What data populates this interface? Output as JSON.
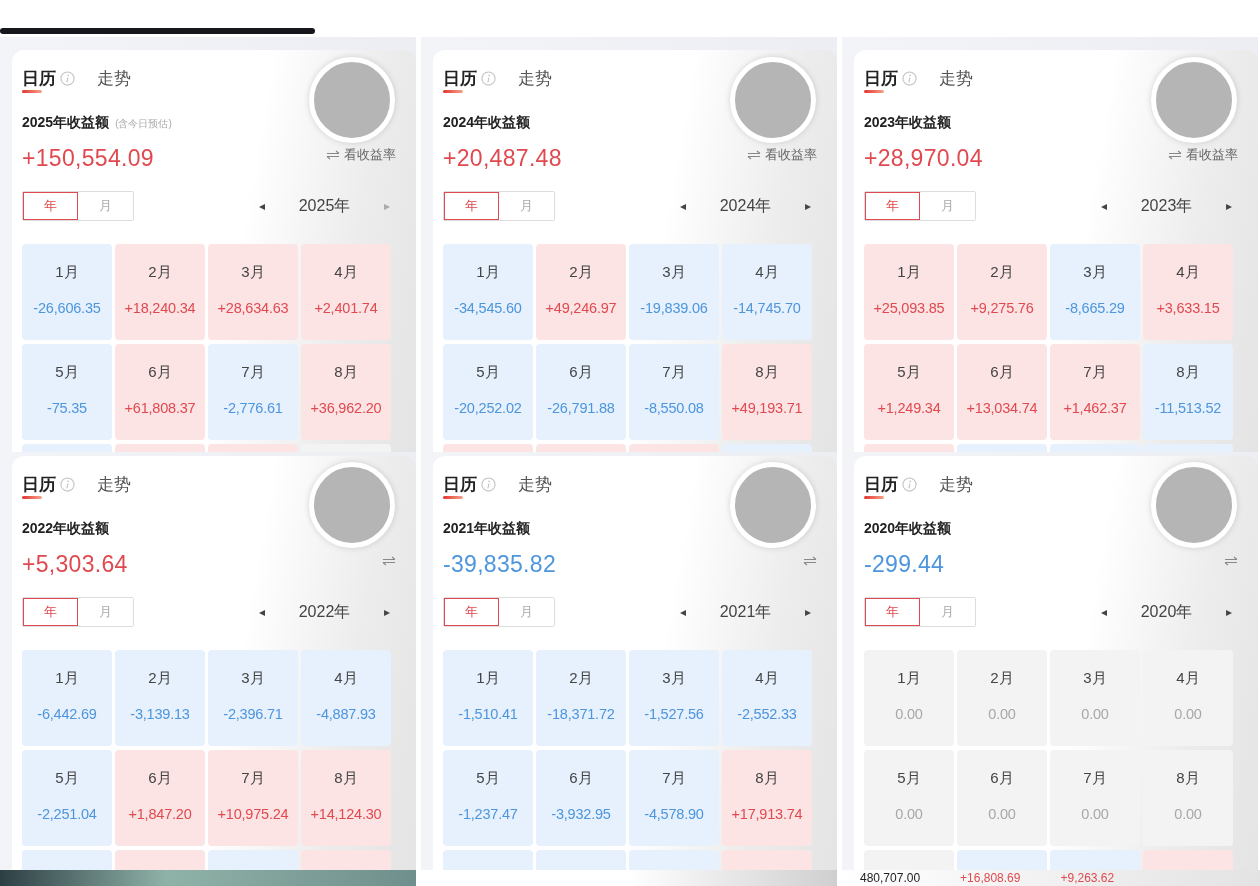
{
  "panels": [
    {
      "tabs": [
        {
          "label": "日历",
          "selected": true
        },
        {
          "label": "走势",
          "selected": false
        }
      ],
      "title": "2025年收益额",
      "title_note": "(含今日预估)",
      "amount": "+150,554.09",
      "kind": "gain",
      "rate_link": "看收益率",
      "segments": [
        {
          "label": "年",
          "selected": true
        },
        {
          "label": "月",
          "selected": false
        }
      ],
      "prev": "◂",
      "year": "2025年",
      "next": "▸",
      "next_disabled": true,
      "months": [
        {
          "label": "1月",
          "value": "-26,606.35",
          "kind": "loss"
        },
        {
          "label": "2月",
          "value": "+18,240.34",
          "kind": "gain"
        },
        {
          "label": "3月",
          "value": "+28,634.63",
          "kind": "gain"
        },
        {
          "label": "4月",
          "value": "+2,401.74",
          "kind": "gain"
        },
        {
          "label": "5月",
          "value": "-75.35",
          "kind": "loss"
        },
        {
          "label": "6月",
          "value": "+61,808.37",
          "kind": "gain"
        },
        {
          "label": "7月",
          "value": "-2,776.61",
          "kind": "loss"
        },
        {
          "label": "8月",
          "value": "+36,962.20",
          "kind": "gain"
        }
      ],
      "partial_row": [
        {
          "kind": "loss"
        },
        {
          "kind": "gain"
        },
        {
          "kind": "gain"
        },
        {
          "kind": "flat"
        }
      ]
    },
    {
      "tabs": [
        {
          "label": "日历",
          "selected": true
        },
        {
          "label": "走势",
          "selected": false
        }
      ],
      "title": "2024年收益额",
      "amount": "+20,487.48",
      "kind": "gain",
      "rate_link": "看收益率",
      "segments": [
        {
          "label": "年",
          "selected": true
        },
        {
          "label": "月",
          "selected": false
        }
      ],
      "prev": "◂",
      "year": "2024年",
      "next": "▸",
      "next_disabled": false,
      "months": [
        {
          "label": "1月",
          "value": "-34,545.60",
          "kind": "loss"
        },
        {
          "label": "2月",
          "value": "+49,246.97",
          "kind": "gain"
        },
        {
          "label": "3月",
          "value": "-19,839.06",
          "kind": "loss"
        },
        {
          "label": "4月",
          "value": "-14,745.70",
          "kind": "loss"
        },
        {
          "label": "5月",
          "value": "-20,252.02",
          "kind": "loss"
        },
        {
          "label": "6月",
          "value": "-26,791.88",
          "kind": "loss"
        },
        {
          "label": "7月",
          "value": "-8,550.08",
          "kind": "loss"
        },
        {
          "label": "8月",
          "value": "+49,193.71",
          "kind": "gain"
        }
      ],
      "partial_row": [
        {
          "kind": "gain"
        },
        {
          "kind": "gain"
        },
        {
          "kind": "gain"
        },
        {
          "kind": "loss"
        }
      ]
    },
    {
      "tabs": [
        {
          "label": "日历",
          "selected": true
        },
        {
          "label": "走势",
          "selected": false
        }
      ],
      "title": "2023年收益额",
      "amount": "+28,970.04",
      "kind": "gain",
      "rate_link": "看收益率",
      "segments": [
        {
          "label": "年",
          "selected": true
        },
        {
          "label": "月",
          "selected": false
        }
      ],
      "prev": "◂",
      "year": "2023年",
      "next": "▸",
      "next_disabled": false,
      "months": [
        {
          "label": "1月",
          "value": "+25,093.85",
          "kind": "gain"
        },
        {
          "label": "2月",
          "value": "+9,275.76",
          "kind": "gain"
        },
        {
          "label": "3月",
          "value": "-8,665.29",
          "kind": "loss"
        },
        {
          "label": "4月",
          "value": "+3,633.15",
          "kind": "gain"
        },
        {
          "label": "5月",
          "value": "+1,249.34",
          "kind": "gain"
        },
        {
          "label": "6月",
          "value": "+13,034.74",
          "kind": "gain"
        },
        {
          "label": "7月",
          "value": "+1,462.37",
          "kind": "gain"
        },
        {
          "label": "8月",
          "value": "-11,513.52",
          "kind": "loss"
        }
      ],
      "partial_row": [
        {
          "kind": "gain"
        },
        {
          "kind": "loss"
        },
        {
          "kind": "loss"
        },
        {
          "kind": "loss"
        }
      ]
    },
    {
      "tabs": [
        {
          "label": "日历",
          "selected": true
        },
        {
          "label": "走势",
          "selected": false
        }
      ],
      "title": "2022年收益额",
      "amount": "+5,303.64",
      "kind": "gain",
      "segments": [
        {
          "label": "年",
          "selected": true
        },
        {
          "label": "月",
          "selected": false
        }
      ],
      "prev": "◂",
      "year": "2022年",
      "next": "▸",
      "next_disabled": false,
      "months": [
        {
          "label": "1月",
          "value": "-6,442.69",
          "kind": "loss"
        },
        {
          "label": "2月",
          "value": "-3,139.13",
          "kind": "loss"
        },
        {
          "label": "3月",
          "value": "-2,396.71",
          "kind": "loss"
        },
        {
          "label": "4月",
          "value": "-4,887.93",
          "kind": "loss"
        },
        {
          "label": "5月",
          "value": "-2,251.04",
          "kind": "loss"
        },
        {
          "label": "6月",
          "value": "+1,847.20",
          "kind": "gain"
        },
        {
          "label": "7月",
          "value": "+10,975.24",
          "kind": "gain"
        },
        {
          "label": "8月",
          "value": "+14,124.30",
          "kind": "gain"
        }
      ],
      "partial_row": [
        {
          "kind": "loss"
        },
        {
          "kind": "gain"
        },
        {
          "kind": "loss"
        },
        {
          "kind": "gain"
        }
      ]
    },
    {
      "tabs": [
        {
          "label": "日历",
          "selected": true
        },
        {
          "label": "走势",
          "selected": false
        }
      ],
      "title": "2021年收益额",
      "amount": "-39,835.82",
      "kind": "loss",
      "segments": [
        {
          "label": "年",
          "selected": true
        },
        {
          "label": "月",
          "selected": false
        }
      ],
      "prev": "◂",
      "year": "2021年",
      "next": "▸",
      "next_disabled": false,
      "months": [
        {
          "label": "1月",
          "value": "-1,510.41",
          "kind": "loss"
        },
        {
          "label": "2月",
          "value": "-18,371.72",
          "kind": "loss"
        },
        {
          "label": "3月",
          "value": "-1,527.56",
          "kind": "loss"
        },
        {
          "label": "4月",
          "value": "-2,552.33",
          "kind": "loss"
        },
        {
          "label": "5月",
          "value": "-1,237.47",
          "kind": "loss"
        },
        {
          "label": "6月",
          "value": "-3,932.95",
          "kind": "loss"
        },
        {
          "label": "7月",
          "value": "-4,578.90",
          "kind": "loss"
        },
        {
          "label": "8月",
          "value": "+17,913.74",
          "kind": "gain"
        }
      ],
      "partial_row": [
        {
          "kind": "loss"
        },
        {
          "kind": "loss"
        },
        {
          "kind": "loss"
        },
        {
          "kind": "gain"
        }
      ]
    },
    {
      "tabs": [
        {
          "label": "日历",
          "selected": true
        },
        {
          "label": "走势",
          "selected": false
        }
      ],
      "title": "2020年收益额",
      "amount": "-299.44",
      "kind": "loss",
      "segments": [
        {
          "label": "年",
          "selected": true
        },
        {
          "label": "月",
          "selected": false
        }
      ],
      "prev": "◂",
      "year": "2020年",
      "next": "▸",
      "next_disabled": false,
      "months": [
        {
          "label": "1月",
          "value": "0.00",
          "kind": "flat"
        },
        {
          "label": "2月",
          "value": "0.00",
          "kind": "flat"
        },
        {
          "label": "3月",
          "value": "0.00",
          "kind": "flat"
        },
        {
          "label": "4月",
          "value": "0.00",
          "kind": "flat"
        },
        {
          "label": "5月",
          "value": "0.00",
          "kind": "flat"
        },
        {
          "label": "6月",
          "value": "0.00",
          "kind": "flat"
        },
        {
          "label": "7月",
          "value": "0.00",
          "kind": "flat"
        },
        {
          "label": "8月",
          "value": "0.00",
          "kind": "flat"
        }
      ],
      "partial_row": [
        {
          "kind": "flat"
        },
        {
          "kind": "loss"
        },
        {
          "kind": "loss"
        },
        {
          "kind": "gain"
        }
      ]
    }
  ],
  "bottom_strip": {
    "values": [
      {
        "text": "480,707.00",
        "kind": "flat"
      },
      {
        "text": "+16,808.69",
        "kind": "gain"
      },
      {
        "text": "+9,263.62",
        "kind": "gain"
      }
    ]
  }
}
